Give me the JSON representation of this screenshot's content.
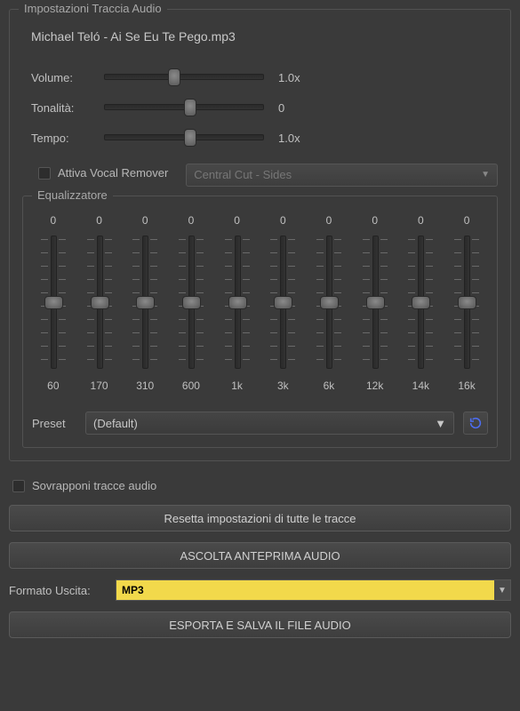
{
  "panel": {
    "title": "Impostazioni Traccia Audio",
    "filename": "Michael Teló - Ai Se Eu Te Pego.mp3"
  },
  "sliders": {
    "volume": {
      "label": "Volume:",
      "value": "1.0x",
      "pos": 0.4
    },
    "pitch": {
      "label": "Tonalità:",
      "value": "0",
      "pos": 0.5
    },
    "tempo": {
      "label": "Tempo:",
      "value": "1.0x",
      "pos": 0.5
    }
  },
  "vocal": {
    "checkbox_label": "Attiva Vocal Remover",
    "dropdown_value": "Central Cut - Sides"
  },
  "equalizer": {
    "title": "Equalizzatore",
    "bands": [
      {
        "value": "0",
        "freq": "60"
      },
      {
        "value": "0",
        "freq": "170"
      },
      {
        "value": "0",
        "freq": "310"
      },
      {
        "value": "0",
        "freq": "600"
      },
      {
        "value": "0",
        "freq": "1k"
      },
      {
        "value": "0",
        "freq": "3k"
      },
      {
        "value": "0",
        "freq": "6k"
      },
      {
        "value": "0",
        "freq": "12k"
      },
      {
        "value": "0",
        "freq": "14k"
      },
      {
        "value": "0",
        "freq": "16k"
      }
    ],
    "preset_label": "Preset",
    "preset_value": "(Default)"
  },
  "bottom": {
    "overlap_label": "Sovrapponi tracce audio",
    "reset_btn": "Resetta impostazioni di tutte le tracce",
    "preview_btn": "ASCOLTA ANTEPRIMA AUDIO",
    "format_label": "Formato Uscita:",
    "format_value": "MP3",
    "export_btn": "ESPORTA E SALVA IL FILE AUDIO"
  }
}
